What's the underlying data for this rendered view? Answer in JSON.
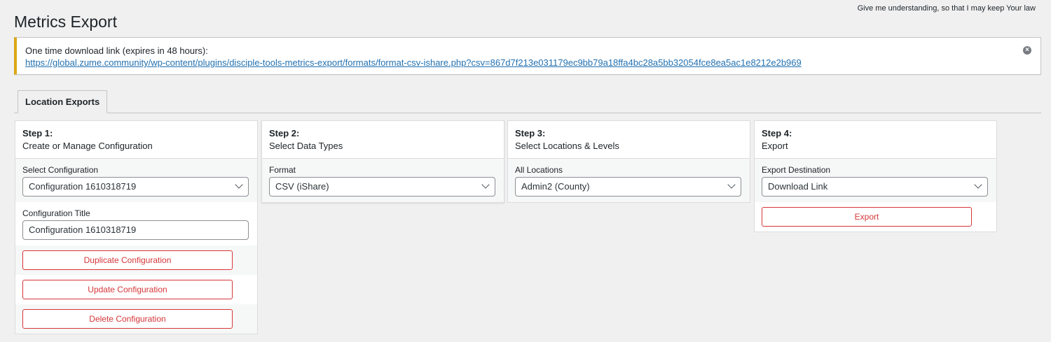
{
  "header": {
    "verse": "Give me understanding, so that I may keep Your law",
    "title": "Metrics Export"
  },
  "notice": {
    "message": "One time download link (expires in 48 hours):",
    "link": "https://global.zume.community/wp-content/plugins/disciple-tools-metrics-export/formats/format-csv-ishare.php?csv=867d7f213e031179ec9bb79a18ffa4bc28a5bb32054fce8ea5ac1e8212e2b969",
    "dismiss_icon": "close-circle-icon"
  },
  "tabs": [
    {
      "label": "Location Exports",
      "active": true
    }
  ],
  "steps": [
    {
      "step": "Step 1:",
      "subtitle": "Create or Manage Configuration",
      "select_label": "Select Configuration",
      "select_value": "Configuration 1610318719",
      "title_label": "Configuration Title",
      "title_value": "Configuration 1610318719",
      "duplicate": "Duplicate Configuration",
      "update": "Update Configuration",
      "delete": "Delete Configuration"
    },
    {
      "step": "Step 2:",
      "subtitle": "Select Data Types",
      "field_label": "Format",
      "field_value": "CSV (iShare)"
    },
    {
      "step": "Step 3:",
      "subtitle": "Select Locations & Levels",
      "field_label": "All Locations",
      "field_value": "Admin2 (County)"
    },
    {
      "step": "Step 4:",
      "subtitle": "Export",
      "field_label": "Export Destination",
      "field_value": "Download Link",
      "export": "Export"
    }
  ],
  "colors": {
    "notice_border": "#dba617",
    "danger": "#d63638",
    "link": "#2271b1"
  }
}
